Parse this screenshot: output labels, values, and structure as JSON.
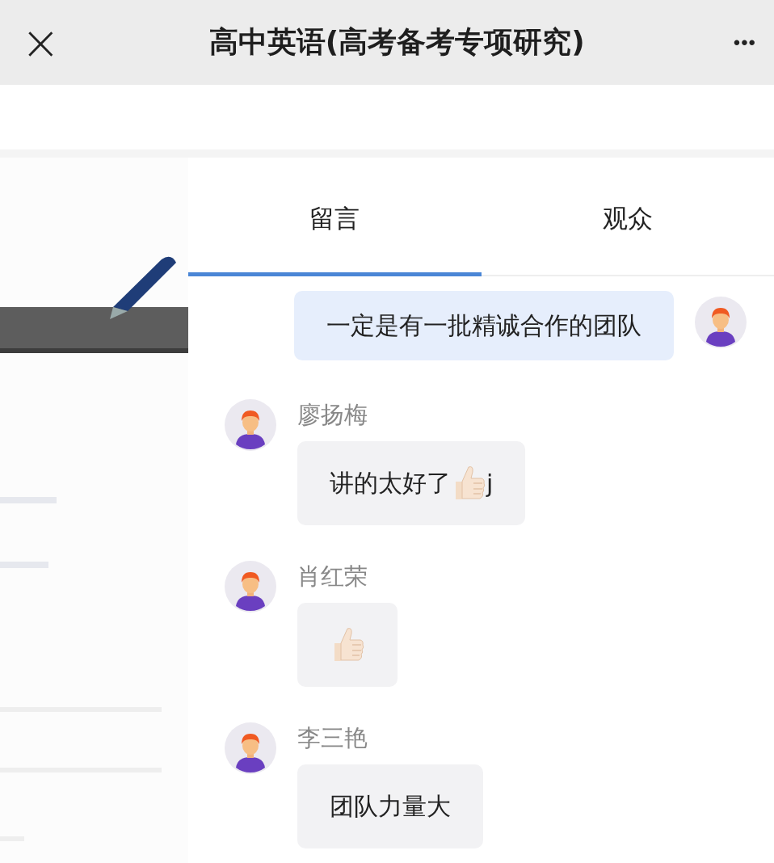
{
  "header": {
    "close_label": "×",
    "title": "高中英语(高考备考专项研究)",
    "more_label": "•••"
  },
  "tabs": [
    {
      "label": "留言",
      "selected": true
    },
    {
      "label": "观众",
      "selected": false
    }
  ],
  "messages": [
    {
      "kind": "own",
      "parts": [
        {
          "kind": "text",
          "text": "一定是有一批精诚合作的团队"
        }
      ]
    },
    {
      "kind": "other",
      "name": "廖扬梅",
      "parts": [
        {
          "kind": "text",
          "text": "讲的太好了"
        },
        {
          "kind": "thumb"
        },
        {
          "kind": "text",
          "text": "j"
        }
      ]
    },
    {
      "kind": "other",
      "name": "肖红荣",
      "parts": [
        {
          "kind": "thumb"
        }
      ]
    },
    {
      "kind": "other",
      "name": "李三艳",
      "parts": [
        {
          "kind": "text",
          "text": "团队力量大"
        }
      ]
    }
  ]
}
